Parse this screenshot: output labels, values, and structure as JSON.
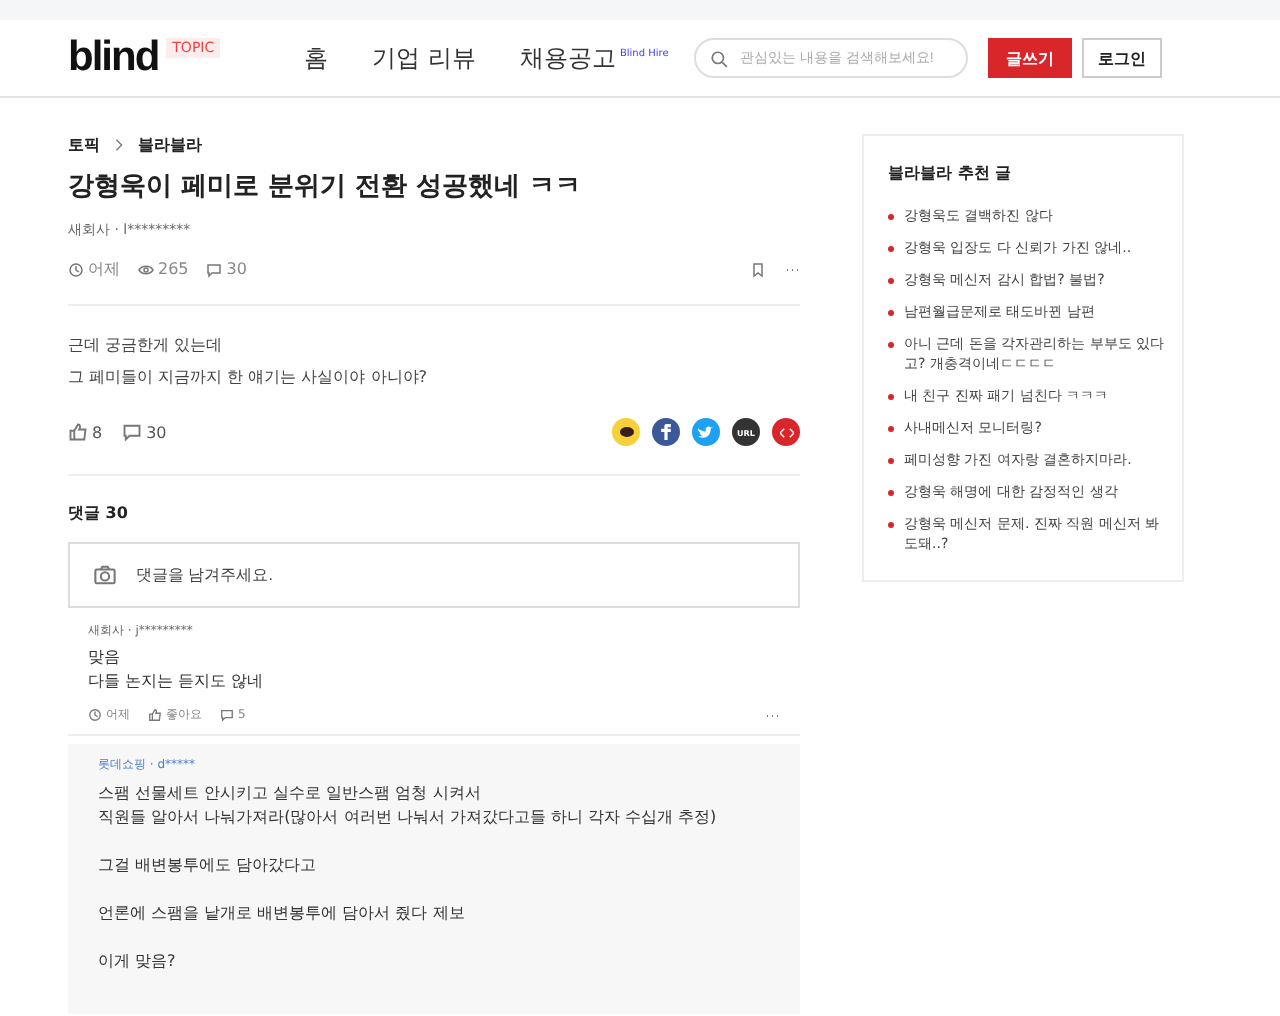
{
  "header": {
    "logo": "blind",
    "badge": "TOPIC",
    "nav": [
      {
        "label": "홈"
      },
      {
        "label": "기업 리뷰"
      },
      {
        "label": "채용공고",
        "sup": "Blind Hire"
      }
    ],
    "search": {
      "placeholder": "관심있는 내용을 검색해보세요!"
    },
    "write_button": "글쓰기",
    "login_button": "로그인"
  },
  "breadcrumb": [
    "토픽",
    "블라블라"
  ],
  "post": {
    "title": "강형욱이 페미로 분위기 전환 성공했네 ㅋㅋ",
    "author": "새회사 · l*********",
    "time": "어제",
    "views": "265",
    "comments": "30",
    "body": [
      "근데 궁금한게 있는데",
      "그 페미들이 지금까지 한 얘기는 사실이야 아니야?"
    ],
    "likes": "8",
    "comment_count": "30",
    "share": [
      {
        "kind": "kakao",
        "color": "#f7d13a"
      },
      {
        "kind": "facebook",
        "color": "#3b5998"
      },
      {
        "kind": "twitter",
        "color": "#1da1f2"
      },
      {
        "kind": "url",
        "color": "#333333",
        "label": "URL"
      },
      {
        "kind": "embed",
        "color": "#d9262b"
      }
    ]
  },
  "comments_heading": "댓글 30",
  "comment_input": {
    "placeholder": "댓글을 남겨주세요."
  },
  "comments": [
    {
      "author": "새회사 · j*********",
      "lines": [
        "맞음",
        "다들 논지는 듣지도 않네"
      ],
      "time": "어제",
      "like": "좋아요",
      "replies": "5"
    }
  ],
  "reply": {
    "author": "롯데쇼핑 · d*****",
    "paragraphs": [
      "스팸 선물세트 안시키고 실수로 일반스팸 엄청 시켜서\n직원들 알아서 나눠가져라(많아서 여러번 나눠서 가져갔다고들 하니 각자 수십개 추정)",
      "그걸 배변봉투에도 담아갔다고",
      "언론에 스팸을 낱개로 배변봉투에 담아서 줬다 제보",
      "이게 맞음?"
    ]
  },
  "sidebar": {
    "title": "블라블라 추천 글",
    "items": [
      "강형욱도 결백하진 않다",
      "강형욱 입장도 다 신뢰가 가진 않네..",
      "강형욱 메신저 감시 합법? 불법?",
      "남편월급문제로 태도바뀐 남편",
      "아니 근데 돈을 각자관리하는 부부도 있다고? 개충격이네ㄷㄷㄷㄷ",
      "내 친구 진짜 패기 넘친다 ㅋㅋㅋ",
      "사내메신저 모니터링?",
      "페미성향 가진 여자랑 결혼하지마라.",
      "강형욱 해명에 대한 감정적인 생각",
      "강형욱 메신저 문제. 진짜 직원 메신저 봐도돼..?"
    ]
  }
}
